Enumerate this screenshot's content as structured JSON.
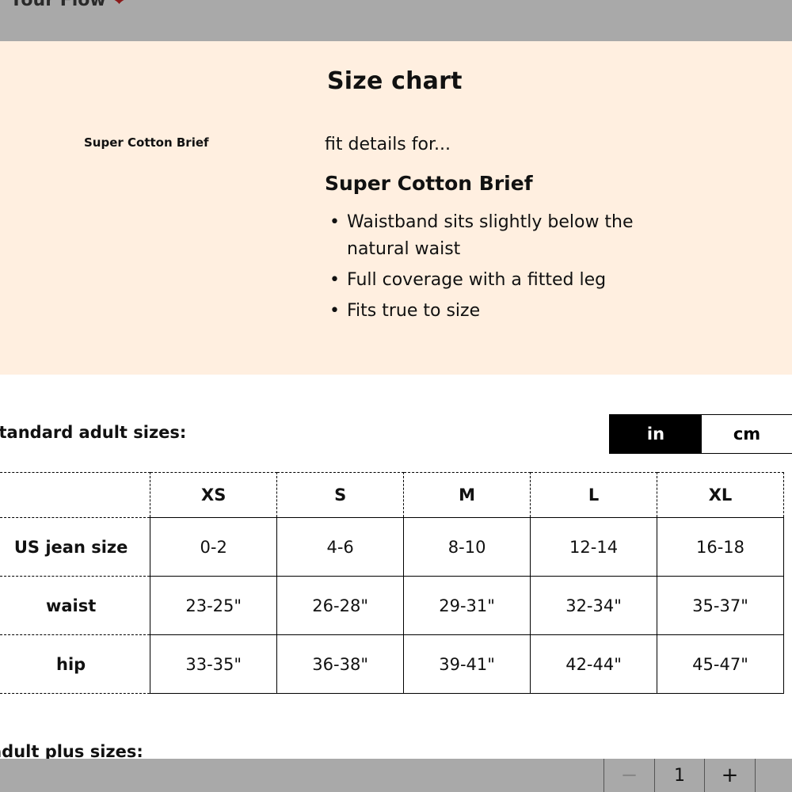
{
  "topbar": {
    "text": "r Your Flow",
    "heart": "❤"
  },
  "panel": {
    "title": "Size chart",
    "thumb_label": "Super Cotton Brief",
    "fit_for": "fit details for...",
    "product_name": "Super Cotton Brief",
    "bullets": [
      "Waistband sits slightly below the natural waist",
      "Full coverage with a fitted leg",
      "Fits true to size"
    ]
  },
  "standard": {
    "label": "standard adult sizes:",
    "units": {
      "active": "in",
      "inactive": "cm"
    }
  },
  "table": {
    "columns": [
      "XS",
      "S",
      "M",
      "L",
      "XL"
    ],
    "rows": [
      {
        "label": "US jean size",
        "values": [
          "0-2",
          "4-6",
          "8-10",
          "12-14",
          "16-18"
        ]
      },
      {
        "label": "waist",
        "values": [
          "23-25\"",
          "26-28\"",
          "29-31\"",
          "32-34\"",
          "35-37\""
        ]
      },
      {
        "label": "hip",
        "values": [
          "33-35\"",
          "36-38\"",
          "39-41\"",
          "42-44\"",
          "45-47\""
        ]
      }
    ]
  },
  "plus": {
    "label": "adult plus sizes:"
  },
  "quantity": {
    "minus": "−",
    "value": "1",
    "plus": "+"
  }
}
